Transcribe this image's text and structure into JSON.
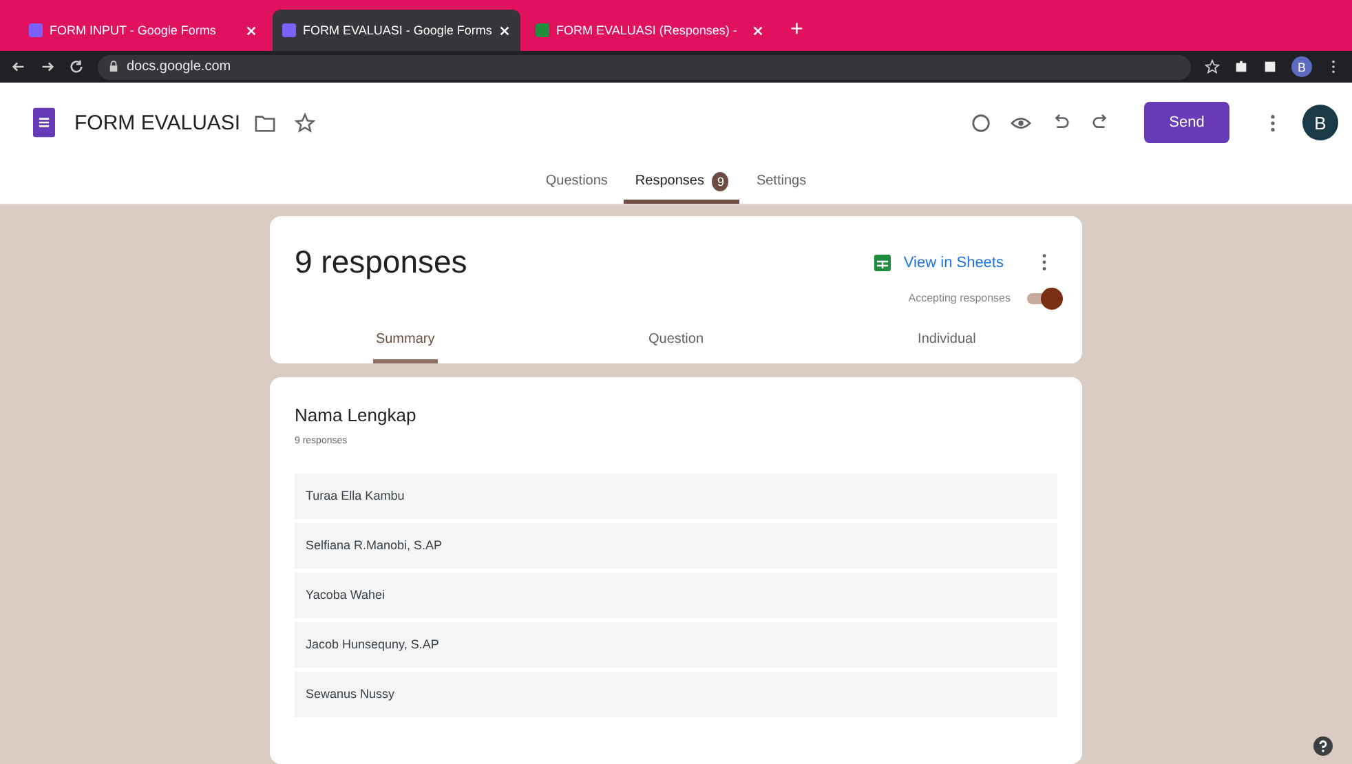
{
  "browser": {
    "tabs": [
      {
        "title": "FORM INPUT - Google Forms",
        "selected": false,
        "kind": "forms"
      },
      {
        "title": "FORM EVALUASI - Google Forms",
        "selected": true,
        "kind": "forms"
      },
      {
        "title": "FORM EVALUASI (Responses) -",
        "selected": false,
        "kind": "sheets"
      }
    ],
    "new_tab": "+",
    "url_host": "docs.google.com",
    "profile": "B"
  },
  "header": {
    "title": "FORM EVALUASI",
    "send": "Send",
    "avatar": "B"
  },
  "form_tabs": [
    {
      "label": "Questions",
      "selected": false
    },
    {
      "label": "Responses",
      "selected": true,
      "badge": "9"
    },
    {
      "label": "Settings",
      "selected": false
    }
  ],
  "summary": {
    "title": "9 responses",
    "view_in_sheets": "View in Sheets",
    "accepting_label": "Accepting responses",
    "accepting": true,
    "tabs": [
      {
        "label": "Summary",
        "selected": true
      },
      {
        "label": "Question",
        "selected": false
      },
      {
        "label": "Individual",
        "selected": false
      }
    ]
  },
  "question": {
    "title": "Nama Lengkap",
    "count": "9 responses",
    "answers": [
      "Turaa Ella Kambu",
      "Selfiana R.Manobi, S.AP",
      "Yacoba Wahei",
      "Jacob Hunsequny, S.AP",
      "Sewanus Nussy"
    ]
  }
}
